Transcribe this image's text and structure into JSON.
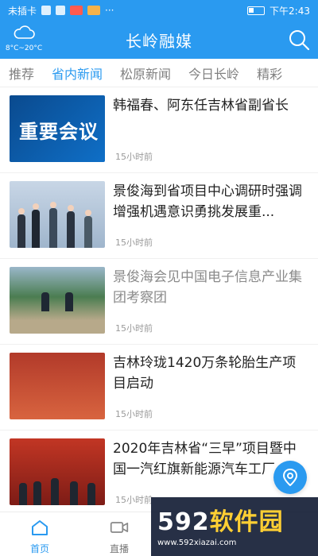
{
  "status_bar": {
    "carrier": "未插卡",
    "time": "下午2:43"
  },
  "header": {
    "title": "长岭融媒",
    "weather_temp": "8°C~20°C"
  },
  "tabs": [
    {
      "label": "推荐"
    },
    {
      "label": "省内新闻"
    },
    {
      "label": "松原新闻"
    },
    {
      "label": "今日长岭"
    },
    {
      "label": "精彩"
    }
  ],
  "active_tab_index": 1,
  "news": [
    {
      "headline": "韩福春、阿东任吉林省副省长",
      "time": "15小时前",
      "thumb_text": "重要会议"
    },
    {
      "headline": "景俊海到省项目中心调研时强调 增强机遇意识勇挑发展重...",
      "time": "15小时前"
    },
    {
      "headline": "景俊海会见中国电子信息产业集团考察团",
      "time": "15小时前"
    },
    {
      "headline": "吉林玲珑1420万条轮胎生产项目启动",
      "time": "15小时前"
    },
    {
      "headline": "2020年吉林省“三早”项目暨中国一汽红旗新能源汽车工厂...",
      "time": "15小时前"
    }
  ],
  "bottom_nav": [
    {
      "label": "首页"
    },
    {
      "label": "直播"
    }
  ],
  "watermark": {
    "brand_num": "592",
    "brand_text": "软件园",
    "url": "www.592xiazai.com"
  },
  "colors": {
    "primary": "#2a9af0"
  }
}
